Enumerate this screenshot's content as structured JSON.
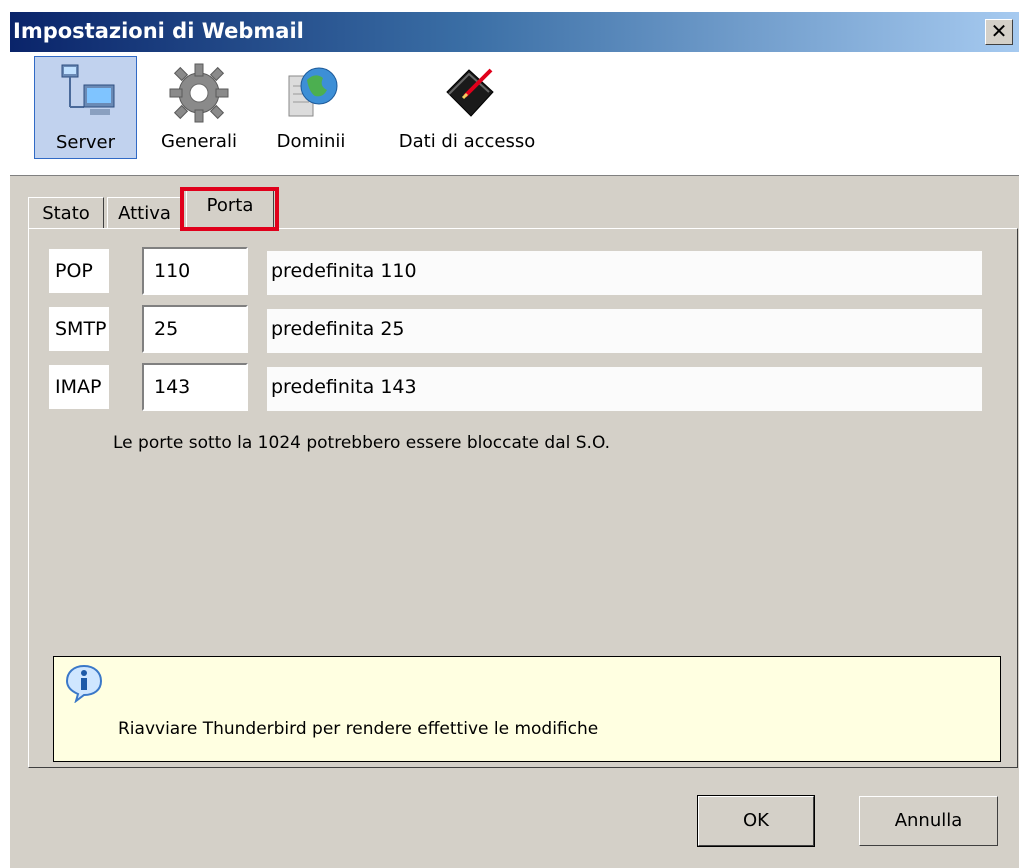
{
  "window": {
    "title": "Impostazioni di Webmail",
    "close_symbol": "✕"
  },
  "toolbar": {
    "items": [
      {
        "label": "Server",
        "icon": "server-icon",
        "active": true
      },
      {
        "label": "Generali",
        "icon": "gear-icon",
        "active": false
      },
      {
        "label": "Dominii",
        "icon": "globe-server-icon",
        "active": false
      },
      {
        "label": "Dati di accesso",
        "icon": "book-pen-icon",
        "active": false
      }
    ]
  },
  "tabs": [
    {
      "label": "Stato",
      "selected": false
    },
    {
      "label": "Attiva",
      "selected": false
    },
    {
      "label": "Porta",
      "selected": true
    }
  ],
  "ports": [
    {
      "label": "POP",
      "value": "110",
      "hint": "predefinita 110"
    },
    {
      "label": "SMTP",
      "value": "25",
      "hint": "predefinita 25"
    },
    {
      "label": "IMAP",
      "value": "143",
      "hint": "predefinita 143"
    }
  ],
  "note": "Le porte sotto la 1024 potrebbero essere bloccate dal S.O.",
  "info": {
    "icon": "info-icon",
    "message": "Riavviare Thunderbird per rendere effettive le modifiche"
  },
  "buttons": {
    "ok": "OK",
    "cancel": "Annulla"
  },
  "colors": {
    "highlight_border": "#e0001b",
    "selection": "#0a246a",
    "info_bg": "#ffffe1"
  }
}
